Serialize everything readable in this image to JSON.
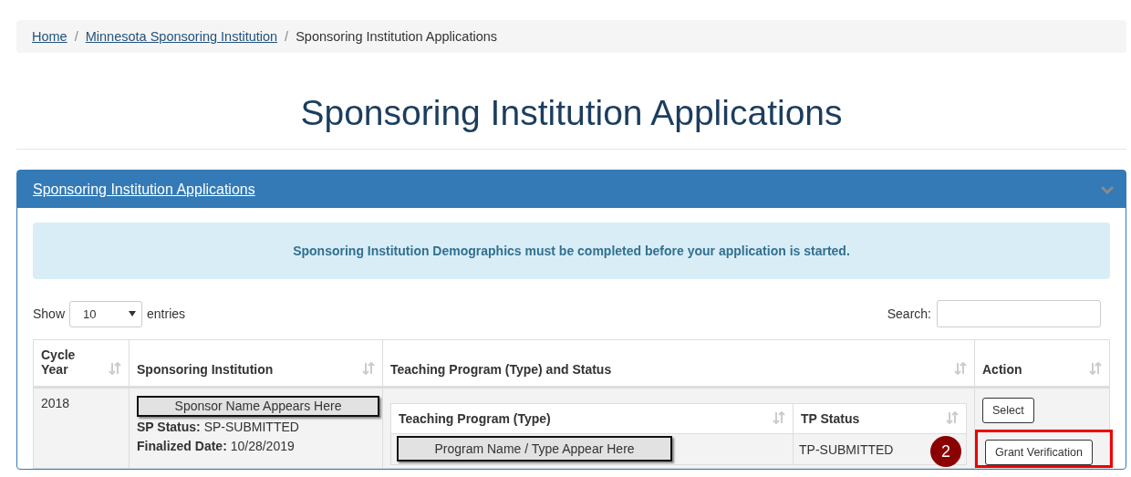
{
  "breadcrumb_separator": "/",
  "breadcrumb": [
    {
      "label": "Home",
      "kind": "link"
    },
    {
      "label": "Minnesota Sponsoring Institution",
      "kind": "link"
    },
    {
      "label": "Sponsoring Institution Applications",
      "kind": "current"
    }
  ],
  "title": "Sponsoring Institution Applications",
  "panel": {
    "title": "Sponsoring Institution Applications",
    "alert": "Sponsoring Institution Demographics must be completed before your application is started.",
    "length": {
      "before": "Show",
      "value": "10",
      "after": "entries"
    },
    "search": {
      "label": "Search:"
    },
    "table": {
      "columns": [
        "Cycle Year",
        "Sponsoring Institution",
        "Teaching Program (Type) and Status",
        "Action"
      ],
      "rows": [
        {
          "cycle_year": "2018",
          "sponsor_name": "Sponsor Name Appears Here",
          "sp_status": "**SP Status:** SP-SUBMITTED",
          "finalized": "**Finalized Date:** 10/28/2019",
          "programs": {
            "columns": [
              "Teaching Program (Type)",
              "TP Status"
            ],
            "rows": [
              {
                "name": "Program Name / Type Appear Here",
                "status": "TP-SUBMITTED"
              }
            ]
          },
          "actions": [
            {
              "label": "Select",
              "highlighted": false
            },
            {
              "label": "Grant Verification",
              "highlighted": true,
              "callout": "2"
            }
          ]
        }
      ]
    }
  }
}
